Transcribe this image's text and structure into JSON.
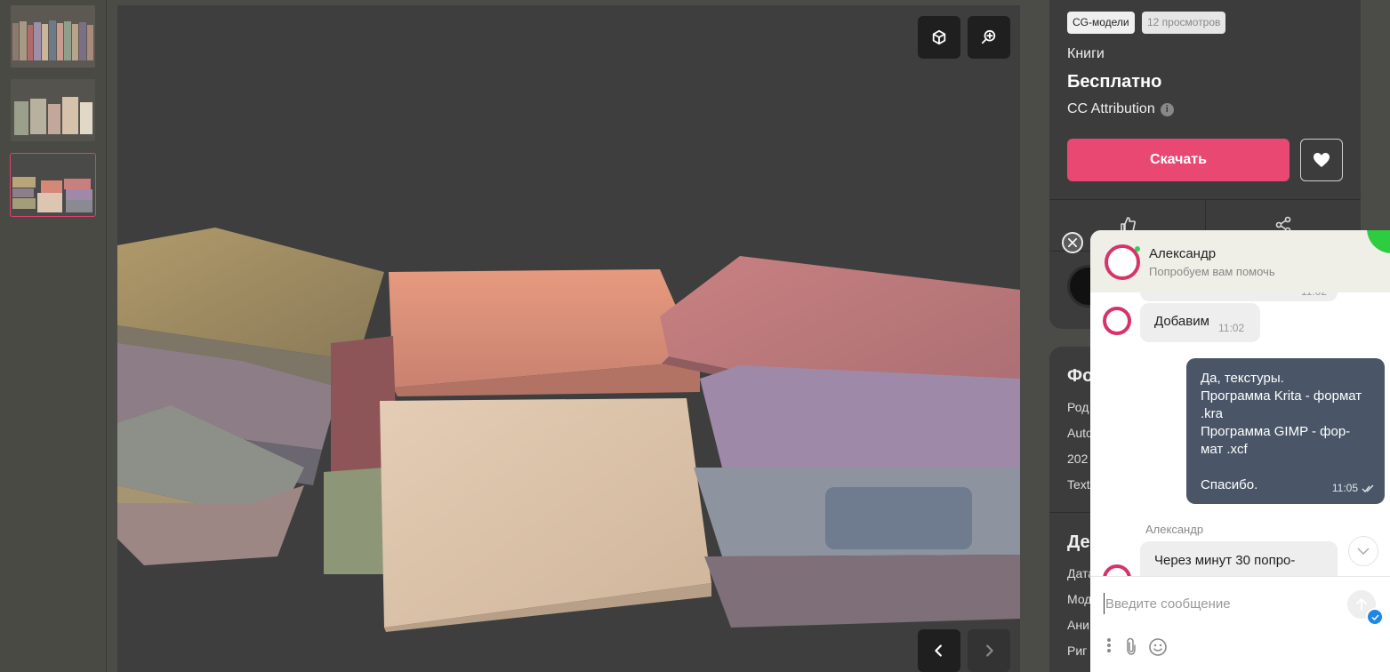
{
  "thumbnails": [
    {
      "name": "books-row"
    },
    {
      "name": "books-standing"
    },
    {
      "name": "books-stacks",
      "active": true
    }
  ],
  "viewer": {
    "btn_3d_icon": "cube-icon",
    "btn_zoom_icon": "zoom-in-icon",
    "prev_icon": "chevron-left-icon",
    "next_icon": "chevron-right-icon"
  },
  "product": {
    "tag_category": "CG-модели",
    "tag_views": "12 просмотров",
    "category": "Книги",
    "price": "Бесплатно",
    "license": "CC Attribution",
    "download_label": "Скачать"
  },
  "section2": {
    "heading1": "Фо",
    "rows1": [
      "Род",
      "Auto",
      "202",
      "Text"
    ],
    "heading2": "Де",
    "rows2": [
      "Дата",
      "Мод",
      "Ани",
      "Риг"
    ]
  },
  "chat": {
    "agent_name": "Александр",
    "agent_status": "Попробуем вам помочь",
    "partial_time": "11:02",
    "msg1_text": "Добавим",
    "msg1_time": "11:02",
    "out_lines": [
      "Да, текстуры.",
      "Программа Krita - формат .kra",
      "Программа GIMP - фор-мат .xcf",
      "",
      "Спасибо."
    ],
    "out_time": "11:05",
    "sender": "Александр",
    "msg2_text": "Через минут 30 попро-",
    "input_placeholder": "Введите сообщение"
  },
  "colors": {
    "accent": "#e94873",
    "ring": "#d6336c",
    "outgoing": "#4a5668",
    "online": "#2ecc40"
  }
}
